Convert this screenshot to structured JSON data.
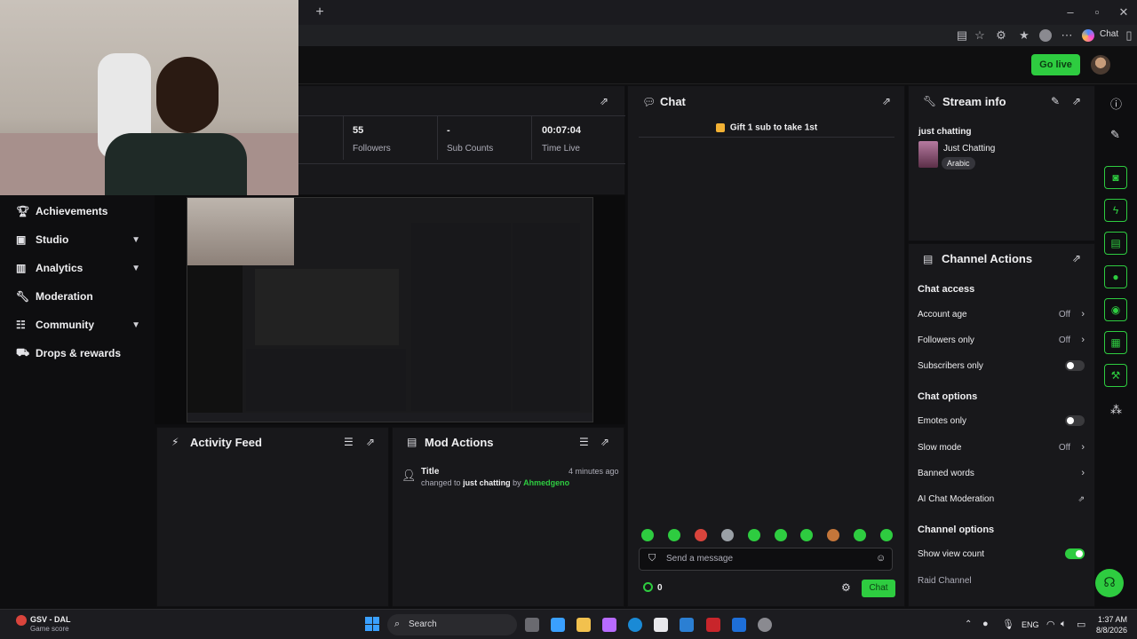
{
  "browser": {
    "copilot_label": "Chat"
  },
  "header": {
    "go_live": "Go live"
  },
  "stats": [
    {
      "value": "55",
      "label": "Followers"
    },
    {
      "value": "-",
      "label": "Sub Counts"
    },
    {
      "value": "00:07:04",
      "label": "Time Live"
    }
  ],
  "nav": [
    {
      "label": "Achievements",
      "icon": "trophy-icon",
      "chevron": false
    },
    {
      "label": "Studio",
      "icon": "studio-icon",
      "chevron": true
    },
    {
      "label": "Analytics",
      "icon": "analytics-icon",
      "chevron": true
    },
    {
      "label": "Moderation",
      "icon": "wrench-icon",
      "chevron": false
    },
    {
      "label": "Community",
      "icon": "community-icon",
      "chevron": true
    },
    {
      "label": "Drops & rewards",
      "icon": "drops-icon",
      "chevron": false
    }
  ],
  "activity": {
    "title": "Activity Feed"
  },
  "mod": {
    "title": "Mod Actions",
    "entry": {
      "title": "Title",
      "time": "4 minutes ago",
      "prefix": "changed to",
      "value": "just chatting",
      "by": "by",
      "user": "Ahmedgeno"
    }
  },
  "chat": {
    "title": "Chat",
    "gift": "Gift 1 sub to take 1st",
    "placeholder": "Send a message",
    "points": "0",
    "send": "Chat"
  },
  "stream_info": {
    "title": "Stream info",
    "stream_title": "just chatting",
    "category": "Just Chatting",
    "tag": "Arabic"
  },
  "channel_actions": {
    "title": "Channel Actions",
    "chat_access": "Chat access",
    "account_age": {
      "label": "Account age",
      "value": "Off"
    },
    "followers_only": {
      "label": "Followers only",
      "value": "Off"
    },
    "subscribers_only": {
      "label": "Subscribers only",
      "on": false
    },
    "chat_options": "Chat options",
    "emotes_only": {
      "label": "Emotes only",
      "on": false
    },
    "slow_mode": {
      "label": "Slow mode",
      "value": "Off"
    },
    "banned_words": {
      "label": "Banned words"
    },
    "ai_moderation": {
      "label": "AI Chat Moderation"
    },
    "channel_options": "Channel options",
    "show_view_count": {
      "label": "Show view count",
      "on": true
    },
    "raid_channel": {
      "label": "Raid Channel"
    }
  },
  "taskbar": {
    "weather_title": "GSV - DAL",
    "weather_sub": "Game score",
    "search": "Search",
    "lang": "ENG",
    "time": "1:37 AM",
    "date": "8/8/2026"
  },
  "colors": {
    "accent": "#2ecc40",
    "panel": "#18181b",
    "bg": "#0e0e10"
  }
}
